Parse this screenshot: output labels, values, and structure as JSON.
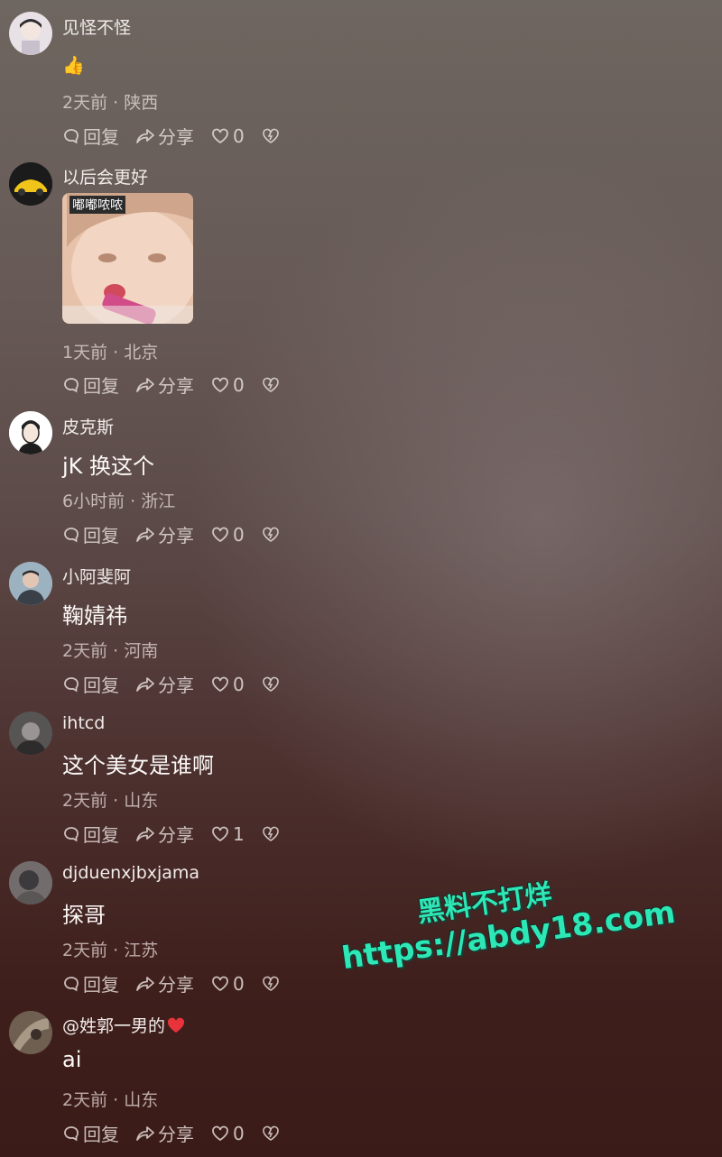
{
  "actions": {
    "reply": "回复",
    "share": "分享"
  },
  "comments": [
    {
      "username": "见怪不怪",
      "text": "👍",
      "time": "2天前",
      "location": "陕西",
      "likes": "0"
    },
    {
      "username": "以后会更好",
      "sticker_caption": "嘟嘟哝哝",
      "time": "1天前",
      "location": "北京",
      "likes": "0"
    },
    {
      "username": "皮克斯",
      "text": "jK 换这个",
      "time": "6小时前",
      "location": "浙江",
      "likes": "0"
    },
    {
      "username": "小阿斐阿",
      "text": "鞠婧祎",
      "time": "2天前",
      "location": "河南",
      "likes": "0"
    },
    {
      "username": "ihtcd",
      "text": "这个美女是谁啊",
      "time": "2天前",
      "location": "山东",
      "likes": "1"
    },
    {
      "username": "djduenxjbxjama",
      "text": "探哥",
      "time": "2天前",
      "location": "江苏",
      "likes": "0"
    },
    {
      "username": "@姓郭一男的",
      "text": "ai",
      "time": "2天前",
      "location": "山东",
      "likes": "0"
    }
  ],
  "separator": "·",
  "watermark": {
    "line1": "黑料不打烊",
    "line2": "https://abdy18.com"
  },
  "colors": {
    "accent_watermark": "#2de8b6",
    "heart_emoji": "#e8333b"
  }
}
